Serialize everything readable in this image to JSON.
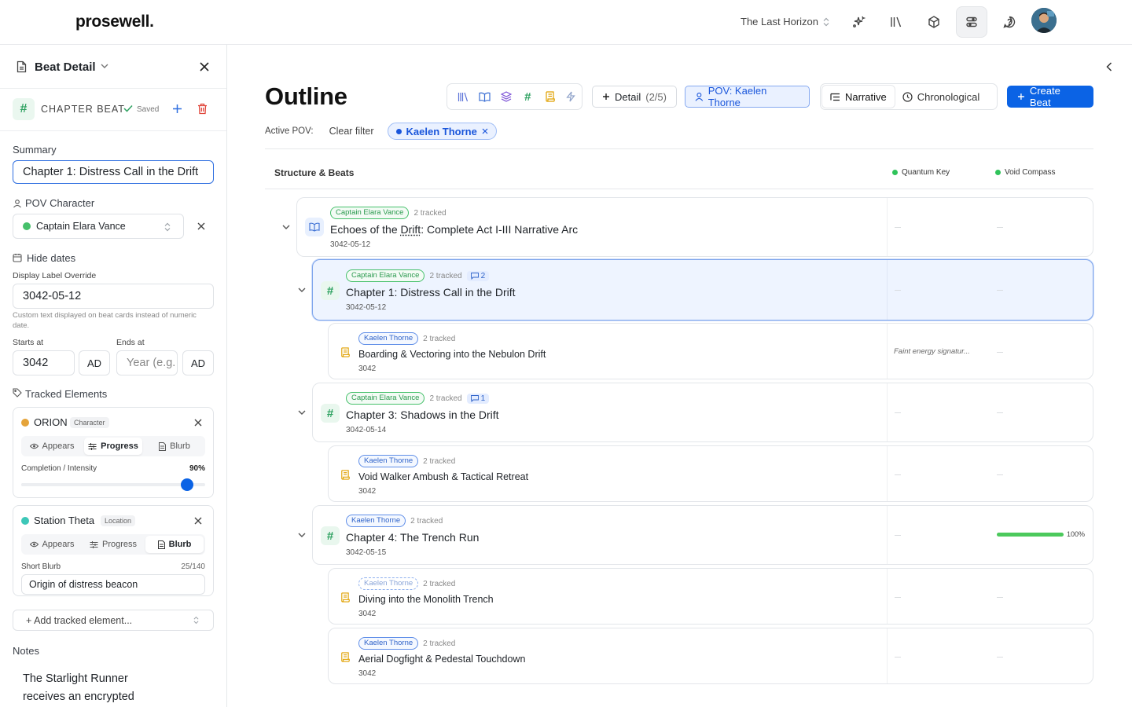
{
  "app": {
    "logo": "prosewell.",
    "project": "The Last Horizon"
  },
  "toolbar_icons": [
    "sparkles-icon",
    "library-icon",
    "cube-icon",
    "sliders-icon",
    "help-icon"
  ],
  "sidebar": {
    "title": "Beat Detail",
    "type_label": "CHAPTER BEAT",
    "saved": "Saved",
    "summary_label": "Summary",
    "summary_value": "Chapter 1: Distress Call in the Drift",
    "pov_label": "POV Character",
    "pov_value": "Captain Elara Vance",
    "hide_dates": "Hide dates",
    "display_label": "Display Label Override",
    "display_value": "3042-05-12",
    "display_help": "Custom text displayed on beat cards instead of numeric date.",
    "starts_label": "Starts at",
    "ends_label": "Ends at",
    "starts_value": "3042",
    "starts_era": "AD",
    "ends_placeholder": "Year (e.g.",
    "ends_era": "AD",
    "tracked_label": "Tracked Elements",
    "elements": [
      {
        "name": "ORION",
        "type": "Character",
        "color": "#e5a43a",
        "tabs": [
          "Appears",
          "Progress",
          "Blurb"
        ],
        "active": 1,
        "field_label": "Completion / Intensity",
        "field_value": "90%",
        "progress": 0.9
      },
      {
        "name": "Station Theta",
        "type": "Location",
        "color": "#3dc7b8",
        "tabs": [
          "Appears",
          "Progress",
          "Blurb"
        ],
        "active": 2,
        "field_label": "Short Blurb",
        "field_count": "25/140",
        "field_value": "Origin of distress beacon"
      }
    ],
    "add_tracked": "+ Add tracked element...",
    "notes_label": "Notes",
    "notes_text_1": "The Starlight Runner",
    "notes_text_2": "receives an encrypted"
  },
  "main": {
    "title": "Outline",
    "detail_btn": "Detail",
    "detail_count": "(2/5)",
    "pov_btn": "POV: Kaelen Thorne",
    "view_narrative": "Narrative",
    "view_chrono": "Chronological",
    "create_btn": "Create Beat",
    "active_pov_label": "Active POV:",
    "clear_filter": "Clear filter",
    "pov_chip": "Kaelen Thorne",
    "table_title": "Structure & Beats",
    "col1": "Quantum Key",
    "col2": "Void Compass",
    "beats": [
      {
        "pov": "Captain Elara Vance",
        "tracked": "2 tracked",
        "comments": "",
        "title_a": "Echoes of the ",
        "title_u": "Drift",
        "title_b": ": Complete Act I-III Narrative Arc",
        "date": "3042-05-12",
        "c1": "—",
        "c2": "—"
      },
      {
        "pov": "Captain Elara Vance",
        "tracked": "2 tracked",
        "comments": "2",
        "title": "Chapter 1: Distress Call in the Drift",
        "date": "3042-05-12",
        "c1": "—",
        "c2": "—"
      },
      {
        "pov": "Kaelen Thorne",
        "tracked": "2 tracked",
        "title": "Boarding & Vectoring into the Nebulon Drift",
        "date": "3042",
        "c1": "Faint energy signatur...",
        "c2": "—"
      },
      {
        "pov": "Captain Elara Vance",
        "tracked": "2 tracked",
        "comments": "1",
        "title": "Chapter 3: Shadows in the Drift",
        "date": "3042-05-14",
        "c1": "—",
        "c2": "—"
      },
      {
        "pov": "Kaelen Thorne",
        "tracked": "2 tracked",
        "title": "Void Walker Ambush & Tactical Retreat",
        "date": "3042",
        "c1": "—",
        "c2": "—"
      },
      {
        "pov": "Kaelen Thorne",
        "tracked": "2 tracked",
        "title": "Chapter 4: The Trench Run",
        "date": "3042-05-15",
        "c1": "—",
        "c2_progress": 1.0,
        "c2_label": "100%"
      },
      {
        "pov": "Kaelen Thorne",
        "tracked": "2 tracked",
        "title": "Diving into the Monolith Trench",
        "date": "3042",
        "c1": "—",
        "c2": "—"
      },
      {
        "pov": "Kaelen Thorne",
        "tracked": "2 tracked",
        "title": "Aerial Dogfight & Pedestal Touchdown",
        "date": "3042",
        "c1": "—",
        "c2": "—"
      }
    ]
  },
  "colors": {
    "primary": "#0b63e5",
    "green": "#46c06b",
    "selected_bg": "#eef4ff"
  }
}
